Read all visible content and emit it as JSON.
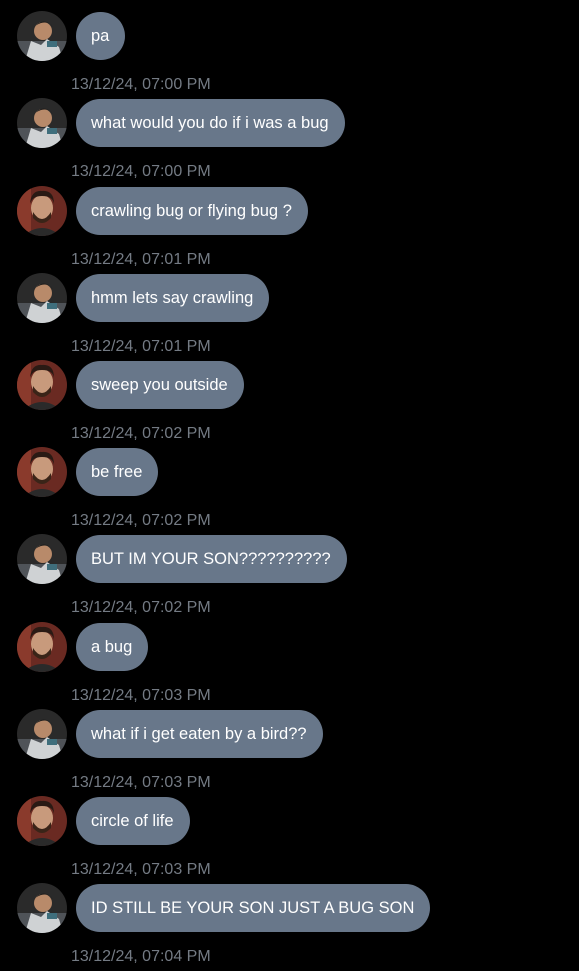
{
  "colors": {
    "background": "#000000",
    "bubble": "#68778a",
    "bubble_text": "#ffffff",
    "timestamp_text": "#747b84"
  },
  "messages": [
    {
      "sender": "son",
      "avatar_icon": "son-avatar-icon",
      "text": "pa",
      "time": "13/12/24, 07:00 PM"
    },
    {
      "sender": "son",
      "avatar_icon": "son-avatar-icon",
      "text": "what would you do if i was a bug",
      "time": "13/12/24, 07:00 PM"
    },
    {
      "sender": "dad",
      "avatar_icon": "dad-avatar-icon",
      "text": "crawling bug or flying bug ?",
      "time": "13/12/24, 07:01 PM"
    },
    {
      "sender": "son",
      "avatar_icon": "son-avatar-icon",
      "text": "hmm lets say crawling",
      "time": "13/12/24, 07:01 PM"
    },
    {
      "sender": "dad",
      "avatar_icon": "dad-avatar-icon",
      "text": "sweep you outside",
      "time": "13/12/24, 07:02 PM"
    },
    {
      "sender": "dad",
      "avatar_icon": "dad-avatar-icon",
      "text": "be free",
      "time": "13/12/24, 07:02 PM"
    },
    {
      "sender": "son",
      "avatar_icon": "son-avatar-icon",
      "text": "BUT IM YOUR SON??????????",
      "time": "13/12/24, 07:02 PM"
    },
    {
      "sender": "dad",
      "avatar_icon": "dad-avatar-icon",
      "text": "a bug",
      "time": "13/12/24, 07:03 PM"
    },
    {
      "sender": "son",
      "avatar_icon": "son-avatar-icon",
      "text": "what if i get eaten by a bird??",
      "time": "13/12/24, 07:03 PM"
    },
    {
      "sender": "dad",
      "avatar_icon": "dad-avatar-icon",
      "text": "circle of life",
      "time": "13/12/24, 07:03 PM"
    },
    {
      "sender": "son",
      "avatar_icon": "son-avatar-icon",
      "text": "ID STILL BE YOUR SON JUST A BUG SON",
      "time": "13/12/24, 07:04 PM"
    }
  ]
}
